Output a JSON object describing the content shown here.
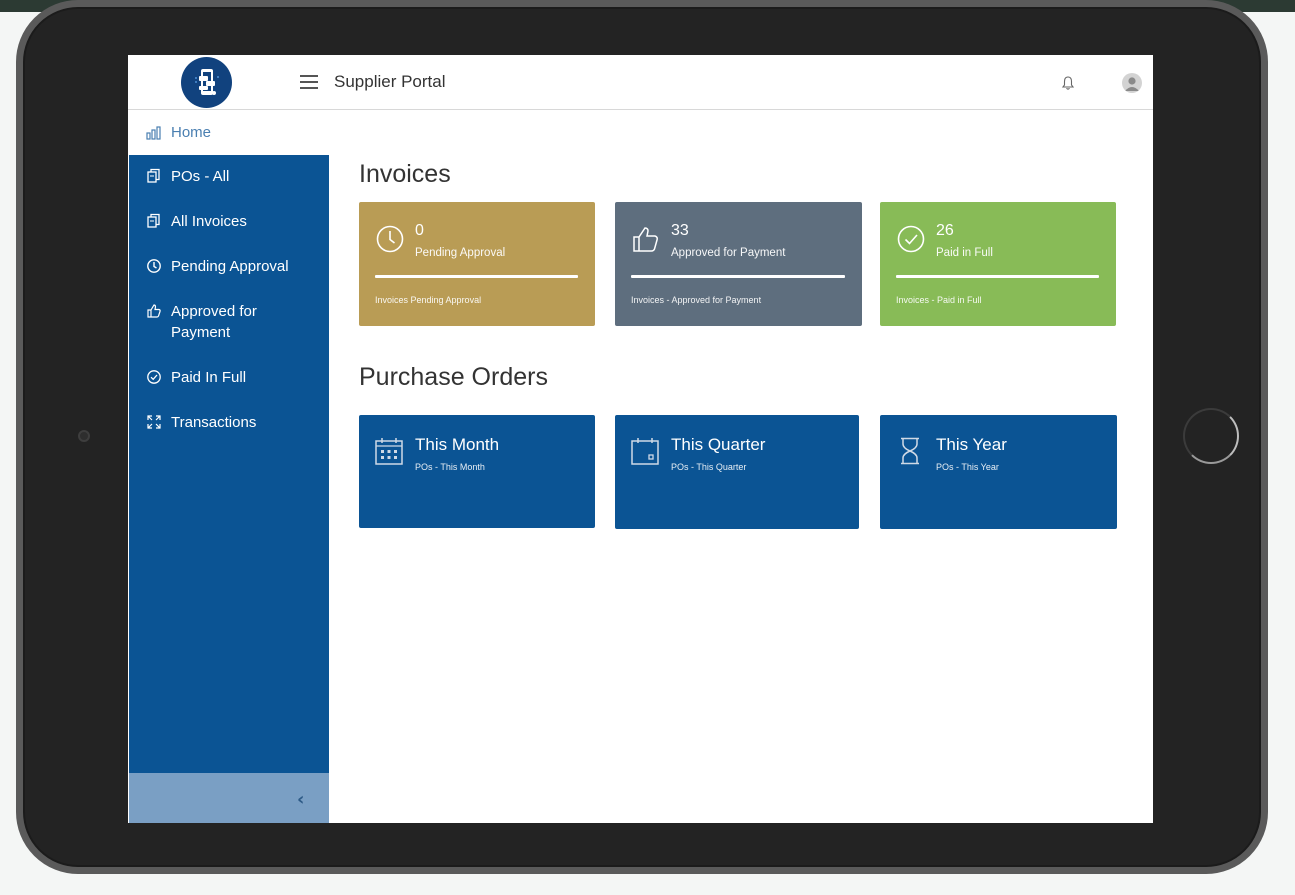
{
  "header": {
    "app_title": "Supplier Portal",
    "logo_icon": "mobile-app-logo-icon",
    "menu_icon": "hamburger-menu-icon",
    "notification_icon": "bell-icon",
    "user_icon": "user-avatar-icon"
  },
  "sidebar": {
    "items": [
      {
        "label": "Home",
        "icon": "bar-chart-icon",
        "active": true
      },
      {
        "label": "POs - All",
        "icon": "documents-icon"
      },
      {
        "label": "All Invoices",
        "icon": "documents-icon"
      },
      {
        "label": "Pending Approval",
        "icon": "clock-icon"
      },
      {
        "label": "Approved for Payment",
        "icon": "thumbs-up-icon"
      },
      {
        "label": "Paid In Full",
        "icon": "check-circle-icon"
      },
      {
        "label": "Transactions",
        "icon": "expand-arrows-icon"
      }
    ],
    "collapse_icon": "chevron-left-icon"
  },
  "invoices": {
    "title": "Invoices",
    "cards": [
      {
        "count": "0",
        "label": "Pending Approval",
        "footer": "Invoices Pending Approval",
        "icon": "clock-icon",
        "color": "#b99c55"
      },
      {
        "count": "33",
        "label": "Approved for Payment",
        "footer": "Invoices - Approved for Payment",
        "icon": "thumbs-up-icon",
        "color": "#5e6e7e"
      },
      {
        "count": "26",
        "label": "Paid in Full",
        "footer": "Invoices - Paid in Full",
        "icon": "check-circle-icon",
        "color": "#88bb57"
      }
    ]
  },
  "purchase_orders": {
    "title": "Purchase Orders",
    "cards": [
      {
        "title": "This Month",
        "subtitle": "POs - This Month",
        "icon": "calendar-grid-icon"
      },
      {
        "title": "This Quarter",
        "subtitle": "POs - This Quarter",
        "icon": "calendar-icon"
      },
      {
        "title": "This Year",
        "subtitle": "POs - This Year",
        "icon": "hourglass-icon"
      }
    ]
  },
  "colors": {
    "sidebar_bg": "#0b5494",
    "active_text": "#4a7fb1",
    "po_card": "#0b5494"
  }
}
